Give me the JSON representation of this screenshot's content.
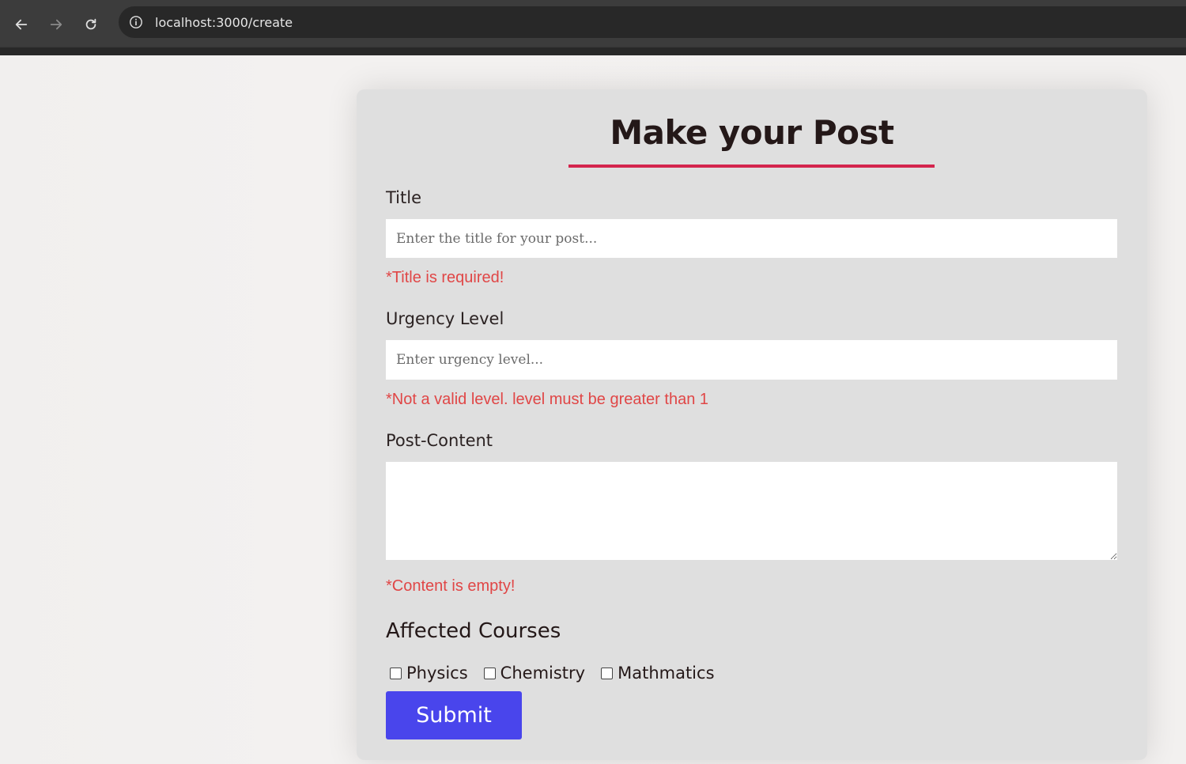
{
  "browser": {
    "url": "localhost:3000/create",
    "icons": [
      "back-arrow-icon",
      "forward-arrow-icon",
      "reload-icon",
      "site-info-icon"
    ]
  },
  "form": {
    "title": "Make your Post",
    "accent_color": "#d4254d",
    "title_field": {
      "label": "Title",
      "placeholder": "Enter the title for your post...",
      "value": "",
      "error": "*Title is required!"
    },
    "urgency_field": {
      "label": "Urgency Level",
      "placeholder": "Enter urgency level...",
      "value": "",
      "error": "*Not a valid level. level must be greater than 1"
    },
    "content_field": {
      "label": "Post-Content",
      "value": "",
      "error": "*Content is empty!"
    },
    "courses": {
      "heading": "Affected Courses",
      "options": [
        {
          "label": "Physics",
          "checked": false
        },
        {
          "label": "Chemistry",
          "checked": false
        },
        {
          "label": "Mathmatics",
          "checked": false
        }
      ]
    },
    "submit_label": "Submit",
    "submit_color": "#4945ec",
    "error_color": "#e04646"
  }
}
